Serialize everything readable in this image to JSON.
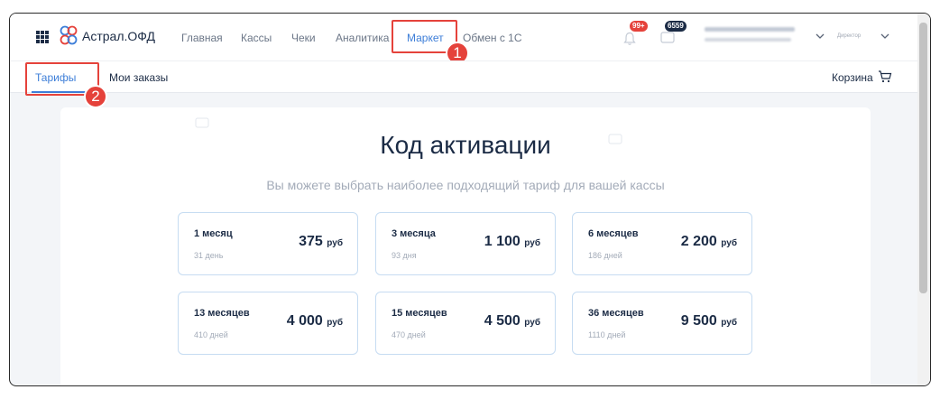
{
  "header": {
    "logo_text": "Астрал.ОФД",
    "nav": [
      "Главная",
      "Кассы",
      "Чеки",
      "Аналитика",
      "Маркет",
      "Обмен с 1С"
    ],
    "notifications_badge": "99+",
    "messages_badge": "6559"
  },
  "callouts": {
    "first": "1",
    "second": "2"
  },
  "tabs": {
    "tariffs": "Тарифы",
    "orders": "Мои заказы"
  },
  "cart": {
    "label": "Корзина"
  },
  "main": {
    "title": "Код активации",
    "subtitle": "Вы можете выбрать наиболее подходящий тариф для вашей кассы",
    "currency": "руб",
    "tariffs": [
      {
        "name": "1 месяц",
        "days": "31 день",
        "price": "375"
      },
      {
        "name": "3 месяца",
        "days": "93 дня",
        "price": "1 100"
      },
      {
        "name": "6 месяцев",
        "days": "186 дней",
        "price": "2 200"
      },
      {
        "name": "13 месяцев",
        "days": "410 дней",
        "price": "4 000"
      },
      {
        "name": "15 месяцев",
        "days": "470 дней",
        "price": "4 500"
      },
      {
        "name": "36 месяцев",
        "days": "1110 дней",
        "price": "9 500"
      }
    ]
  },
  "icons": [
    "apps-grid-icon",
    "astral-logo-icon",
    "bell-icon",
    "chat-icon",
    "chevron-down-icon",
    "cart-icon",
    "card-decoration-icon"
  ],
  "colors": {
    "accent": "#3d7ed8",
    "callout": "#e5423b",
    "text": "#1b2b45",
    "muted": "#a3abb8",
    "card_border": "#c6dcf2"
  }
}
